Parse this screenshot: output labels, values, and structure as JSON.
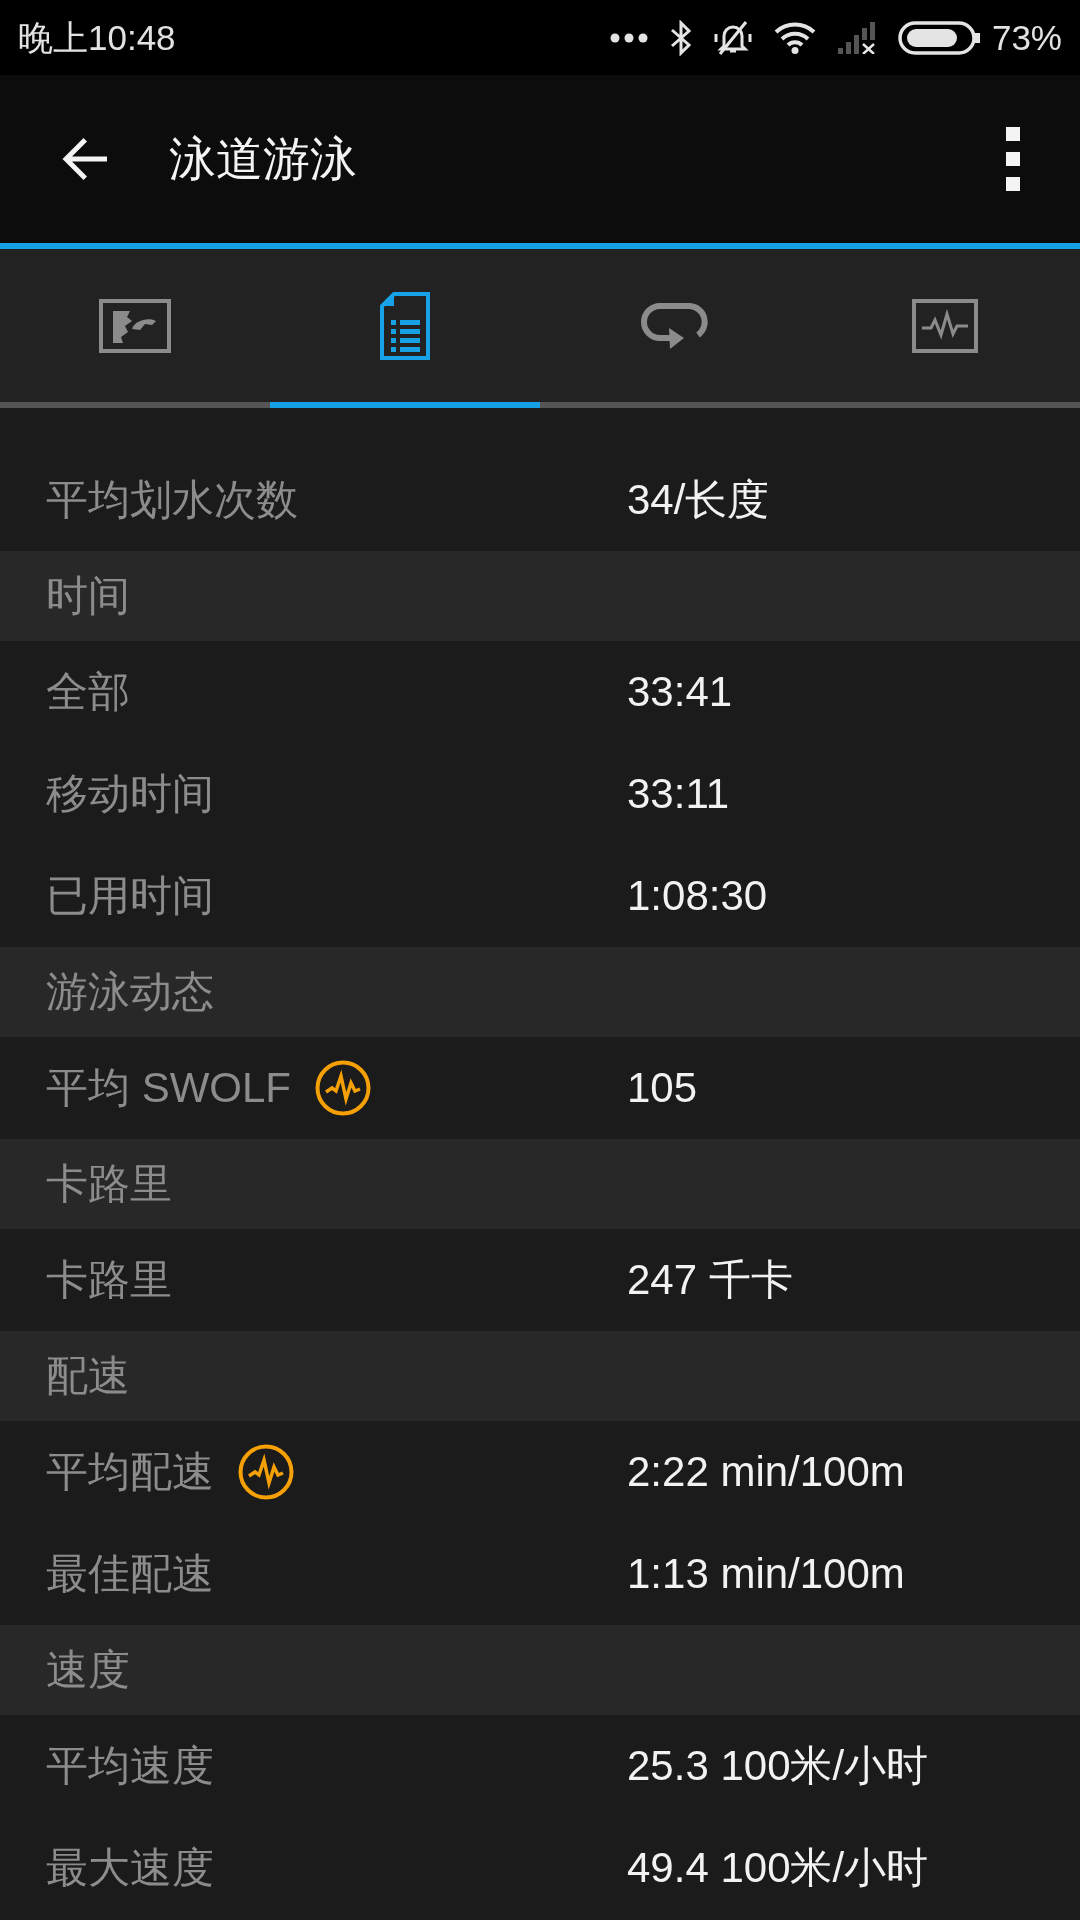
{
  "status_bar": {
    "time": "晚上10:48",
    "battery": "73%"
  },
  "app_bar": {
    "title": "泳道游泳"
  },
  "tabs": [
    {
      "kind": "photo",
      "selected": false
    },
    {
      "kind": "document",
      "selected": true
    },
    {
      "kind": "loop",
      "selected": false
    },
    {
      "kind": "graph",
      "selected": false
    }
  ],
  "sections": [
    {
      "rows": [
        {
          "label": "平均划水次数",
          "value": "34/长度",
          "has_chart": false
        }
      ]
    },
    {
      "title": "时间",
      "rows": [
        {
          "label": "全部",
          "value": "33:41",
          "has_chart": false
        },
        {
          "label": "移动时间",
          "value": "33:11",
          "has_chart": false
        },
        {
          "label": "已用时间",
          "value": "1:08:30",
          "has_chart": false
        }
      ]
    },
    {
      "title": "游泳动态",
      "rows": [
        {
          "label": "平均 SWOLF",
          "value": "105",
          "has_chart": true
        }
      ]
    },
    {
      "title": "卡路里",
      "rows": [
        {
          "label": "卡路里",
          "value": "247 千卡",
          "has_chart": false
        }
      ]
    },
    {
      "title": "配速",
      "rows": [
        {
          "label": "平均配速",
          "value": "2:22 min/100m",
          "has_chart": true
        },
        {
          "label": "最佳配速",
          "value": "1:13 min/100m",
          "has_chart": false
        }
      ]
    },
    {
      "title": "速度",
      "rows": [
        {
          "label": "平均速度",
          "value": "25.3 100米/小时",
          "has_chart": false
        },
        {
          "label": "最大速度",
          "value": "49.4 100米/小时",
          "has_chart": false
        }
      ]
    }
  ]
}
